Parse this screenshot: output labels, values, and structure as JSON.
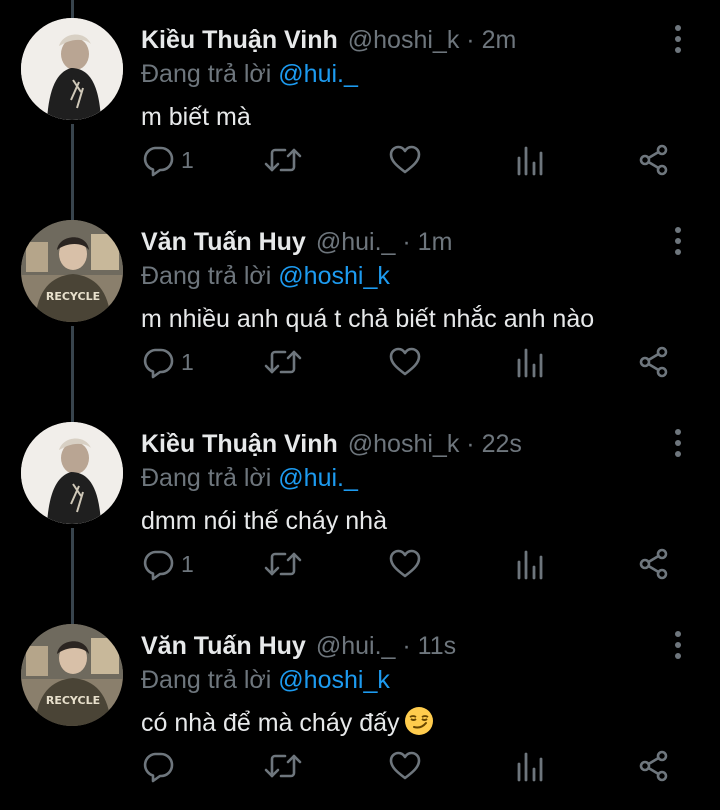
{
  "tweets": [
    {
      "name": "Kiều Thuận Vinh",
      "handle": "@hoshi_k",
      "separator": "·",
      "time": "2m",
      "reply_prefix": "Đang trả lời",
      "reply_to": "@hui._",
      "text": "m biết mà",
      "reply_count": "1",
      "avatar": "vinh"
    },
    {
      "name": "Văn Tuấn Huy",
      "handle": "@hui._",
      "separator": "·",
      "time": "1m",
      "reply_prefix": "Đang trả lời",
      "reply_to": "@hoshi_k",
      "text": "m nhiều anh quá t chả biết nhắc anh nào",
      "reply_count": "1",
      "avatar": "huy"
    },
    {
      "name": "Kiều Thuận Vinh",
      "handle": "@hoshi_k",
      "separator": "·",
      "time": "22s",
      "reply_prefix": "Đang trả lời",
      "reply_to": "@hui._",
      "text": "dmm nói thế cháy nhà",
      "reply_count": "1",
      "avatar": "vinh"
    },
    {
      "name": "Văn Tuấn Huy",
      "handle": "@hui._",
      "separator": "·",
      "time": "11s",
      "reply_prefix": "Đang trả lời",
      "reply_to": "@hoshi_k",
      "text": "có nhà để mà cháy đấy",
      "text_emoji": "smirking-face-emoji",
      "reply_count": "",
      "avatar": "huy"
    }
  ],
  "avatar_shirt_text": "RECYCLE",
  "colors": {
    "background": "#000000",
    "text": "#e7e9ea",
    "muted": "#6e767d",
    "link": "#1d9bf0",
    "thread_line": "#38444d"
  },
  "icons": [
    "reply-icon",
    "retweet-icon",
    "like-icon",
    "analytics-icon",
    "share-icon",
    "more-icon"
  ]
}
